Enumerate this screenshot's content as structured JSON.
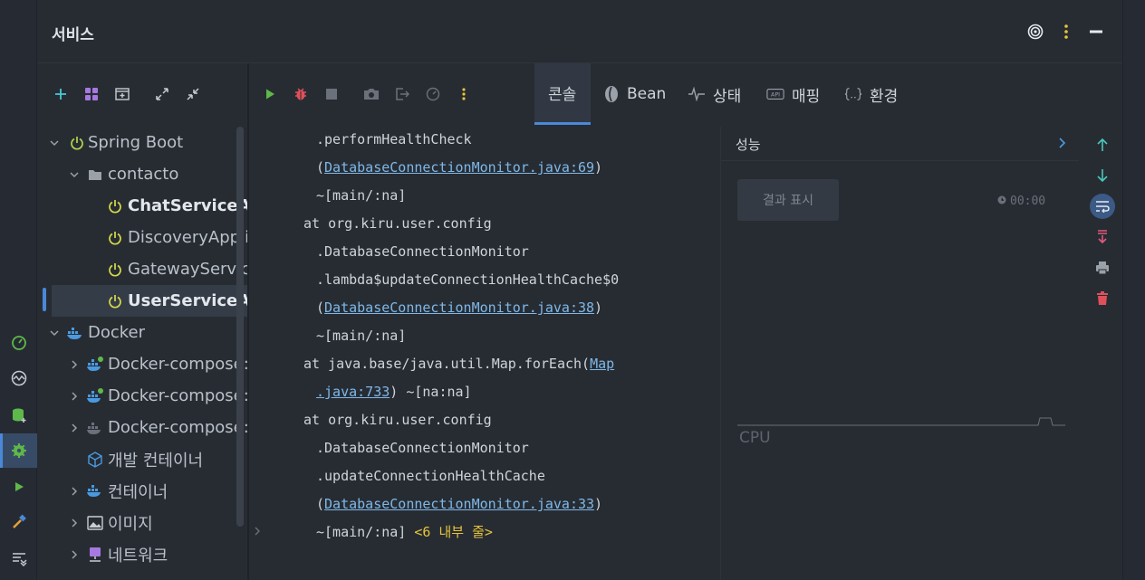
{
  "panel": {
    "title": "서비스"
  },
  "tree": {
    "items": [
      {
        "label": "Spring Boot"
      },
      {
        "label": "contacto"
      },
      {
        "label": "ChatServiceAp"
      },
      {
        "label": "DiscoveryApplic"
      },
      {
        "label": "GatewayService"
      },
      {
        "label": "UserServiceAp"
      },
      {
        "label": "Docker"
      },
      {
        "label": "Docker-compose:"
      },
      {
        "label": "Docker-compose:"
      },
      {
        "label": "Docker-compose:"
      },
      {
        "label": "개발 컨테이너"
      },
      {
        "label": "컨테이너"
      },
      {
        "label": "이미지"
      },
      {
        "label": "네트워크"
      }
    ]
  },
  "tabs": [
    {
      "label": "콘솔"
    },
    {
      "label": "Bean"
    },
    {
      "label": "상태"
    },
    {
      "label": "매핑"
    },
    {
      "label": "환경"
    }
  ],
  "console": {
    "l1": ".performHealthCheck",
    "l2_open": "(",
    "l2_link": "DatabaseConnectionMonitor.java:69",
    "l2_close": ")",
    "l3": "~[main/:na]",
    "l4": "at org.kiru.user.config",
    "l5": ".DatabaseConnectionMonitor",
    "l6": ".lambda$updateConnectionHealthCache$0",
    "l7_open": "(",
    "l7_link": "DatabaseConnectionMonitor.java:38",
    "l7_close": ")",
    "l8": "~[main/:na]",
    "l9_pre": "at java.base/java.util.Map.forEach(",
    "l9_link": "Map",
    "l10_link": ".java:733",
    "l10_post": ") ~[na:na]",
    "l11": "at org.kiru.user.config",
    "l12": ".DatabaseConnectionMonitor",
    "l13": ".updateConnectionHealthCache",
    "l14_open": "(",
    "l14_link": "DatabaseConnectionMonitor.java:33",
    "l14_close": ")",
    "l15_pre": "~[main/:na]",
    "l15_hint": "<6 내부 줄>"
  },
  "perf": {
    "title": "성능",
    "result_button": "결과 표시",
    "timer": "00:00",
    "cpu_label": "CPU"
  },
  "colors": {
    "accent": "#4a88d8",
    "run_green": "#5fb84a",
    "debug_red": "#e0505a",
    "spring_green": "#b4d84a",
    "link": "#7eb8e8",
    "hint_yellow": "#e5c43a"
  }
}
